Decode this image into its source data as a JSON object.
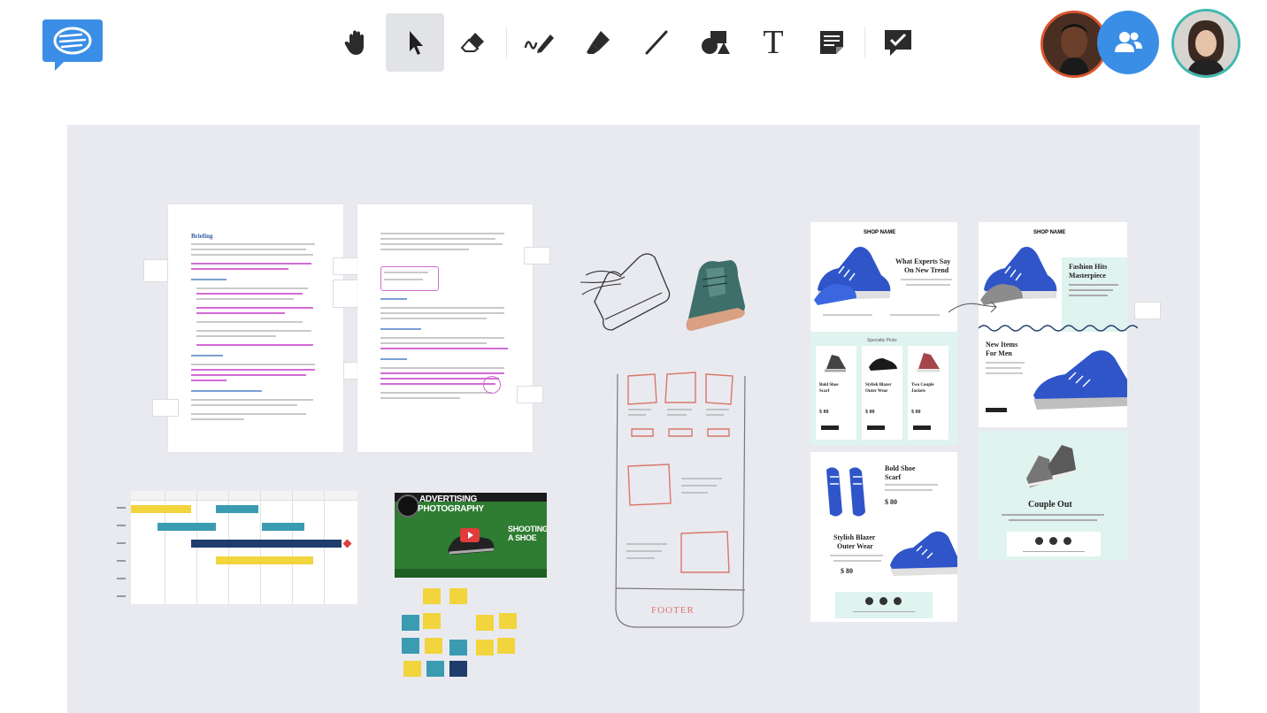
{
  "colors": {
    "brand_blue": "#3a8ee6",
    "canvas_bg": "#e9eaf0",
    "toolbar_active": "#e2e3e6",
    "highlight_pink": "#d26bd6",
    "gantt_yellow": "#f2d43c",
    "gantt_teal": "#3b9bb1",
    "gantt_navy": "#1e3c6c",
    "sketch_red": "#d9776a",
    "mint": "#dff3ef",
    "shoe_blue": "#2f55c9"
  },
  "app": {
    "logo_icon": "chat-bubble-logo-icon"
  },
  "toolbar": {
    "tools": [
      {
        "name": "hand-icon",
        "label": "Pan",
        "active": false
      },
      {
        "name": "pointer-icon",
        "label": "Select",
        "active": true
      },
      {
        "name": "eraser-icon",
        "label": "Eraser",
        "active": false
      },
      {
        "name": "pen-icon",
        "label": "Pen",
        "active": false
      },
      {
        "name": "highlighter-icon",
        "label": "Highlighter",
        "active": false
      },
      {
        "name": "line-icon",
        "label": "Line",
        "active": false
      },
      {
        "name": "shapes-icon",
        "label": "Shapes",
        "active": false
      },
      {
        "name": "text-icon",
        "label": "T",
        "active": false
      },
      {
        "name": "sticky-note-icon",
        "label": "Note",
        "active": false
      },
      {
        "name": "checkmark-comment-icon",
        "label": "Comment",
        "active": false
      }
    ],
    "text_tool_glyph": "T"
  },
  "participants": {
    "people_icon": "people-icon"
  },
  "board": {
    "doc1": {
      "heading": "Briefing"
    },
    "video": {
      "title_line1": "ADVERTISING",
      "title_line2": "PHOTOGRAPHY",
      "subtitle_line1": "SHOOTING",
      "subtitle_line2": "A SHOE"
    },
    "wireframe": {
      "footer": "FOOTER"
    },
    "email1": {
      "shop": "SHOP NAME",
      "headline_line1": "What Experts Say",
      "headline_line2": "On New Trend",
      "section": "Specialty Picks",
      "products": [
        {
          "line1": "Bold Shoe",
          "line2": "Scarf",
          "price": "$ 80"
        },
        {
          "line1": "Stylish Blazer",
          "line2": "Outer Wear",
          "price": "$ 80"
        },
        {
          "line1": "Two Couple",
          "line2": "Jackets",
          "price": "$ 80"
        }
      ],
      "bold_line1": "Bold Shoe",
      "bold_line2": "Scarf",
      "bold_price": "$ 80",
      "stylish_line1": "Stylish Blazer",
      "stylish_line2": "Outer Wear",
      "stylish_price": "$ 80"
    },
    "email2": {
      "shop": "SHOP NAME",
      "headline_line1": "Fashion Hits",
      "headline_line2": "Masterpiece",
      "new_line1": "New Items",
      "new_line2": "For Men",
      "couple": "Couple Out"
    }
  }
}
